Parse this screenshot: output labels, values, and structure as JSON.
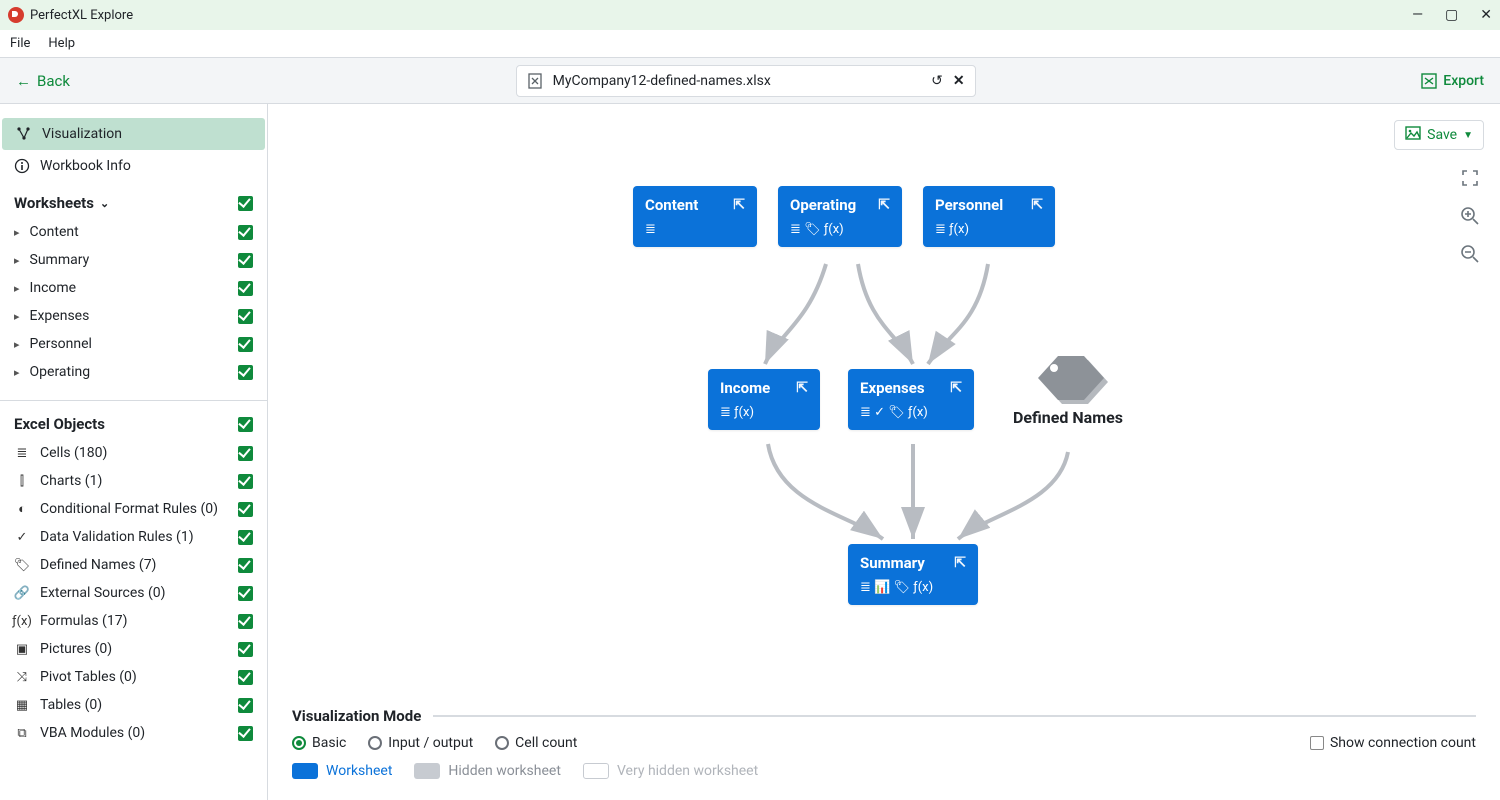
{
  "app": {
    "title": "PerfectXL Explore"
  },
  "menu": {
    "file": "File",
    "help": "Help"
  },
  "header": {
    "back": "Back",
    "filename": "MyCompany12-defined-names.xlsx",
    "export": "Export"
  },
  "sidebar": {
    "nav": {
      "visualization": "Visualization",
      "workbook_info": "Workbook Info"
    },
    "worksheets": {
      "title": "Worksheets",
      "items": [
        {
          "label": "Content"
        },
        {
          "label": "Summary"
        },
        {
          "label": "Income"
        },
        {
          "label": "Expenses"
        },
        {
          "label": "Personnel"
        },
        {
          "label": "Operating"
        }
      ]
    },
    "excel_objects": {
      "title": "Excel Objects",
      "items": [
        {
          "label": "Cells (180)",
          "icon": "list-icon"
        },
        {
          "label": "Charts (1)",
          "icon": "chart-icon"
        },
        {
          "label": "Conditional Format Rules (0)",
          "icon": "conditional-icon"
        },
        {
          "label": "Data Validation Rules (1)",
          "icon": "validation-icon"
        },
        {
          "label": "Defined Names (7)",
          "icon": "tag-icon"
        },
        {
          "label": "External Sources (0)",
          "icon": "link-icon"
        },
        {
          "label": "Formulas (17)",
          "icon": "fx-icon"
        },
        {
          "label": "Pictures (0)",
          "icon": "picture-icon"
        },
        {
          "label": "Pivot Tables (0)",
          "icon": "pivot-icon"
        },
        {
          "label": "Tables (0)",
          "icon": "table-icon"
        },
        {
          "label": "VBA Modules (0)",
          "icon": "vba-icon"
        }
      ]
    }
  },
  "canvas": {
    "save": "Save",
    "defined_names": "Defined Names",
    "nodes": {
      "content": {
        "title": "Content",
        "icons": "≣"
      },
      "operating": {
        "title": "Operating",
        "icons": "≣ 🏷 ƒ(x)"
      },
      "personnel": {
        "title": "Personnel",
        "icons": "≣ ƒ(x)"
      },
      "income": {
        "title": "Income",
        "icons": "≣ ƒ(x)"
      },
      "expenses": {
        "title": "Expenses",
        "icons": "≣ ✓ 🏷 ƒ(x)"
      },
      "summary": {
        "title": "Summary",
        "icons": "≣ 📊 🏷 ƒ(x)"
      }
    }
  },
  "bottom": {
    "title": "Visualization Mode",
    "modes": {
      "basic": "Basic",
      "io": "Input / output",
      "cellcount": "Cell count"
    },
    "show_conn": "Show connection count",
    "legend": {
      "worksheet": "Worksheet",
      "hidden": "Hidden worksheet",
      "veryhidden": "Very hidden worksheet"
    }
  }
}
